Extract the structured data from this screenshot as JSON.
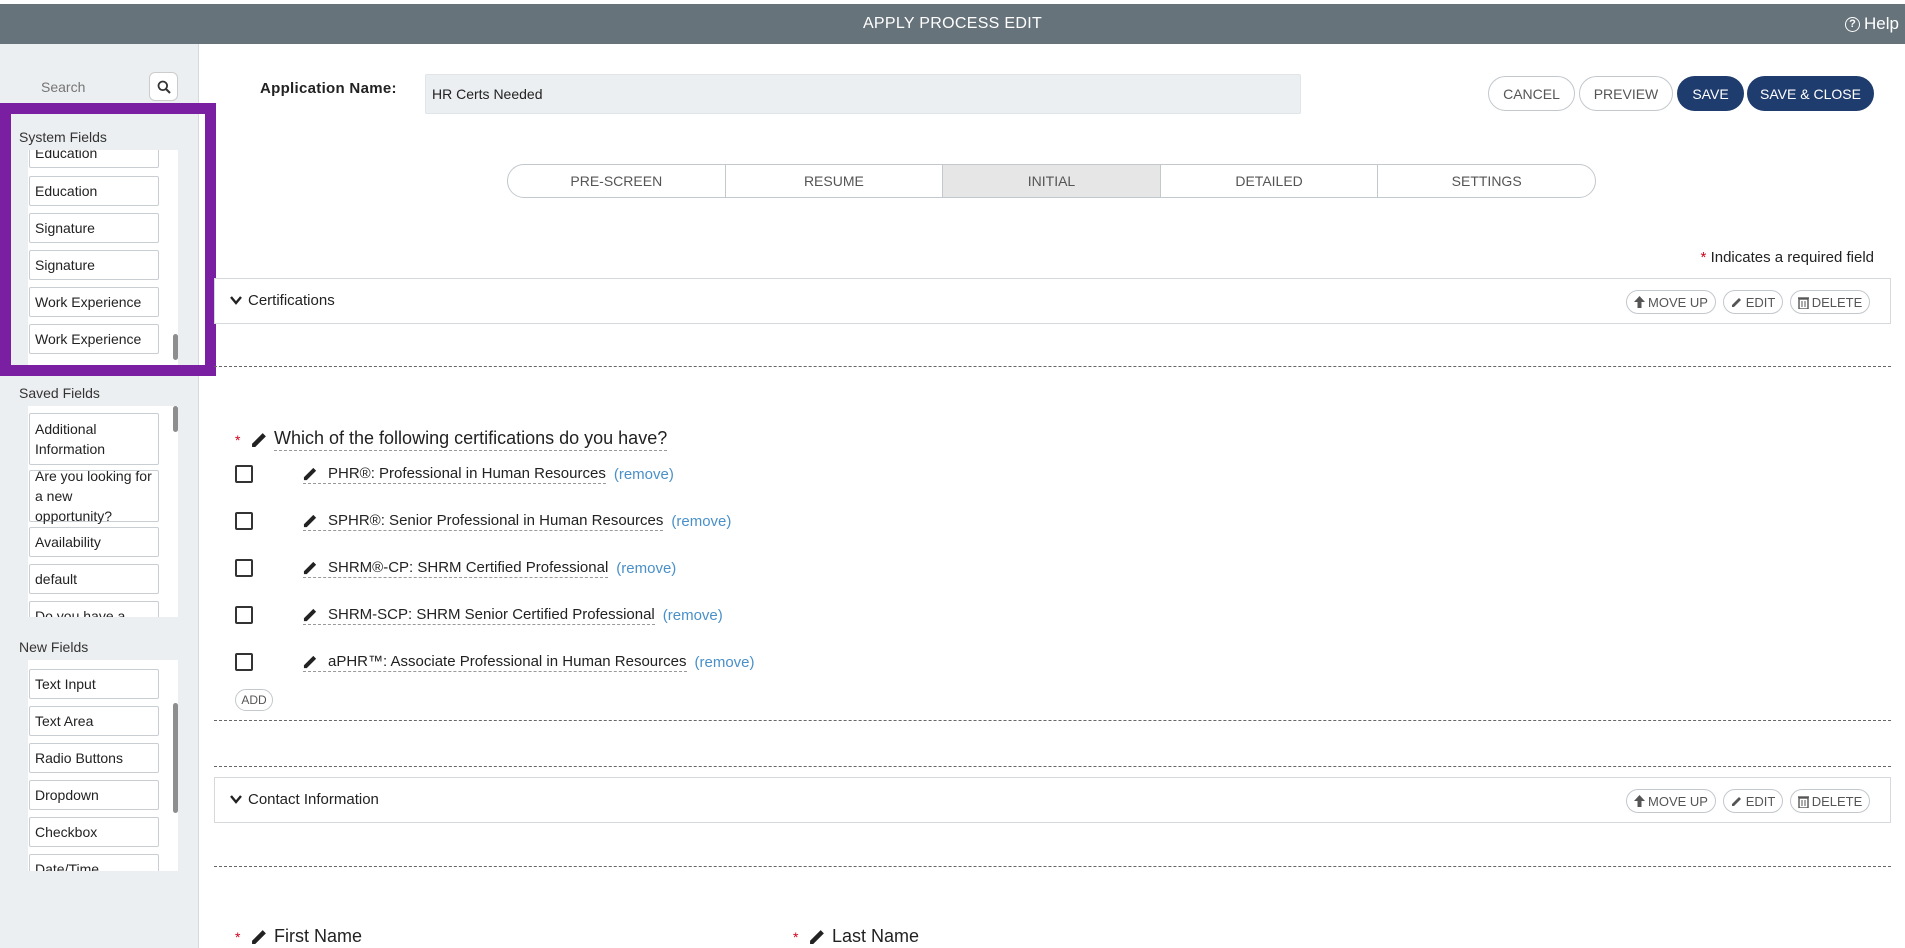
{
  "topbar": {
    "title": "APPLY PROCESS EDIT",
    "help_label": "Help"
  },
  "sidebar": {
    "search_placeholder": "Search",
    "system_fields": {
      "label": "System Fields",
      "items": [
        "Education",
        "Education",
        "Signature",
        "Signature",
        "Work Experience",
        "Work Experience"
      ]
    },
    "saved_fields": {
      "label": "Saved Fields",
      "items": [
        "Additional Information",
        "Are you looking for a new opportunity?",
        "Availability",
        "default",
        "Do you have a"
      ]
    },
    "new_fields": {
      "label": "New Fields",
      "items": [
        "Text Input",
        "Text Area",
        "Radio Buttons",
        "Dropdown",
        "Checkbox",
        "Date/Time"
      ]
    }
  },
  "header": {
    "app_name_label": "Application Name:",
    "app_name_value": "HR Certs Needed",
    "cancel_label": "CANCEL",
    "preview_label": "PREVIEW",
    "save_label": "SAVE",
    "save_close_label": "SAVE & CLOSE"
  },
  "tabs": [
    {
      "label": "PRE-SCREEN",
      "active": false
    },
    {
      "label": "RESUME",
      "active": false
    },
    {
      "label": "INITIAL",
      "active": true
    },
    {
      "label": "DETAILED",
      "active": false
    },
    {
      "label": "SETTINGS",
      "active": false
    }
  ],
  "required_note": {
    "star": "*",
    "text": "Indicates a required field"
  },
  "section_actions": {
    "move_up": "MOVE UP",
    "edit": "EDIT",
    "delete": "DELETE"
  },
  "sections": [
    {
      "title": "Certifications"
    },
    {
      "title": "Contact Information"
    }
  ],
  "question": {
    "required_star": "*",
    "text": "Which of the following certifications do you have?",
    "remove_label": "(remove)",
    "add_label": "ADD",
    "options": [
      "PHR®: Professional in Human Resources",
      "SPHR®: Senior Professional in Human Resources",
      "SHRM®-CP: SHRM Certified Professional",
      "SHRM-SCP: SHRM Senior Certified Professional",
      "aPHR™: Associate Professional in Human Resources"
    ]
  },
  "contact_fields": {
    "first_name": "First Name",
    "last_name": "Last Name",
    "required_star": "*"
  },
  "colors": {
    "topbar": "#67737b",
    "primary": "#1f3c6e",
    "highlight": "#7b1fa2",
    "link": "#4a90c8",
    "required": "#d0021b"
  }
}
